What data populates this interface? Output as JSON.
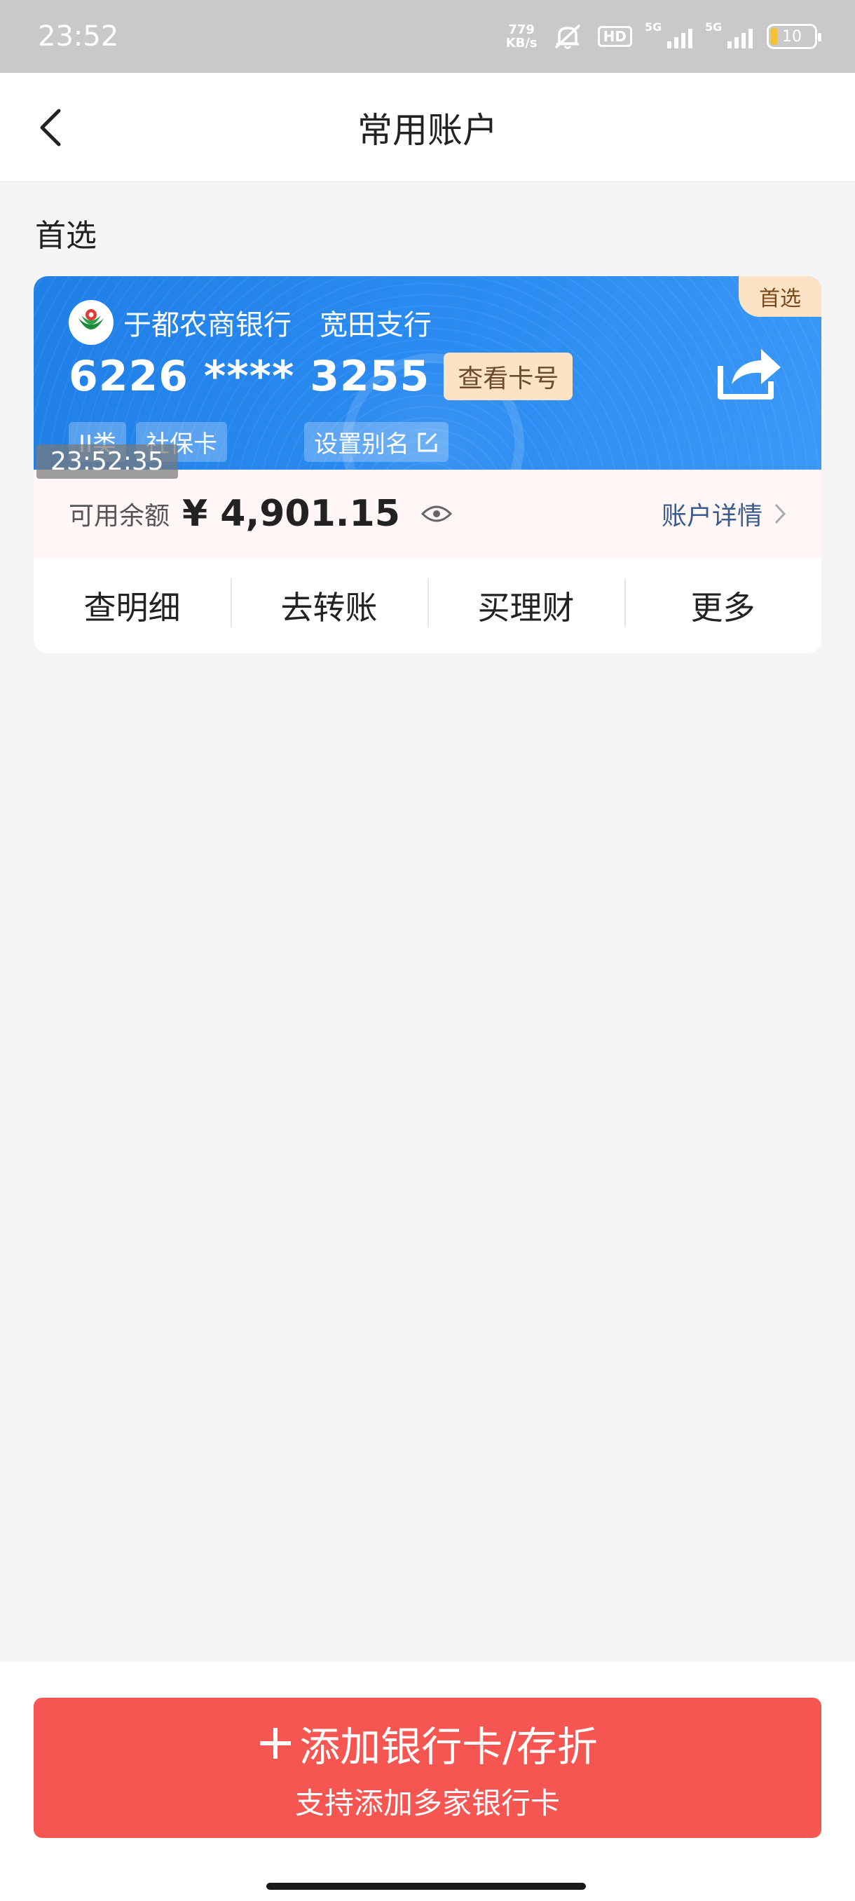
{
  "status_bar": {
    "time": "23:52",
    "net_speed_value": "779",
    "net_speed_unit": "KB/s",
    "hd_label": "HD",
    "signal1_label": "5G",
    "signal2_label": "5G",
    "battery_level": "10"
  },
  "header": {
    "title": "常用账户"
  },
  "section": {
    "label": "首选"
  },
  "card": {
    "badge": "首选",
    "bank_name": "于都农商银行",
    "branch": "宽田支行",
    "card_number": "6226 **** 3255",
    "view_number_label": "查看卡号",
    "tags": [
      "II类",
      "社保卡"
    ],
    "alias_label": "设置别名",
    "timestamp": "23:52:35"
  },
  "balance": {
    "label": "可用余额",
    "value": "¥ 4,901.15",
    "details_label": "账户详情"
  },
  "actions": [
    "查明细",
    "去转账",
    "买理财",
    "更多"
  ],
  "add_card": {
    "title": "添加银行卡/存折",
    "subtitle": "支持添加多家银行卡"
  },
  "colors": {
    "card_blue": "#2b8cf2",
    "add_button_red": "#f65651",
    "badge_peach": "#fde3c6"
  }
}
